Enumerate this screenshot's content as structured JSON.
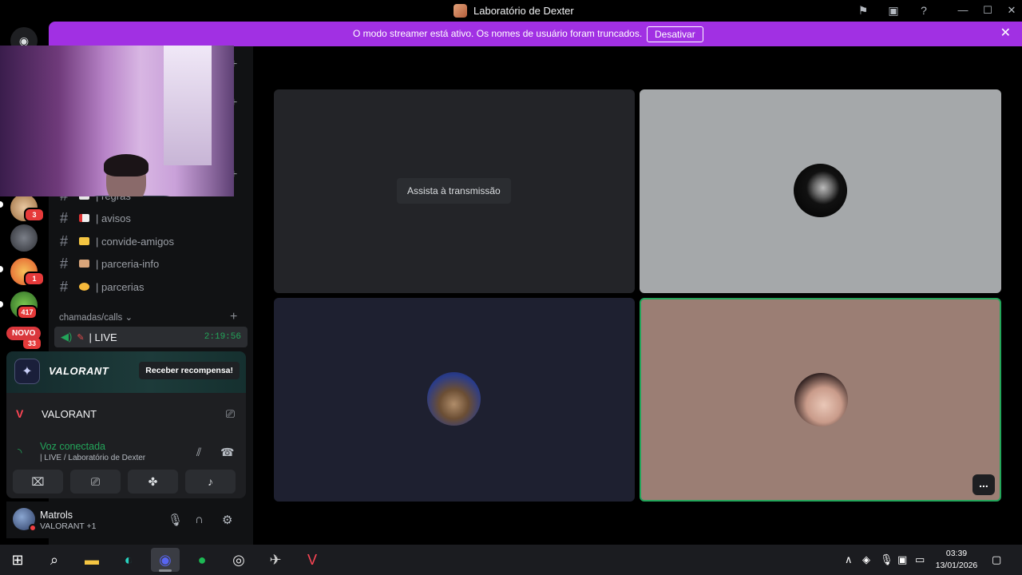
{
  "window": {
    "title": "Laboratório de Dexter"
  },
  "banner": {
    "message": "O modo streamer está ativo. Os nomes de usuário foram truncados.",
    "button_label": "Desativar"
  },
  "rail": {
    "badges": [
      "3",
      "1",
      "417",
      "33"
    ],
    "new_label": "NOVO"
  },
  "sidebar": {
    "channels": [
      {
        "label": "| regras"
      },
      {
        "label": "| avisos"
      },
      {
        "label": "| convide-amigos"
      },
      {
        "label": "| parceria-info"
      },
      {
        "label": "| parcerias"
      }
    ],
    "category": "chamadas/calls",
    "voice_channel": {
      "label": "| LIVE",
      "timer": "2:19:56"
    }
  },
  "activity": {
    "game_name": "VALORANT",
    "cta": "Receber recompensa!"
  },
  "panel": {
    "game": "VALORANT",
    "voice_status": "Voz conectada",
    "voice_location": "| LIVE / Laboratório de Dexter"
  },
  "user": {
    "name": "Matrols",
    "status": "VALORANT +1"
  },
  "stage": {
    "watch_stream": "Assista à transmissão",
    "more": "..."
  },
  "taskbar": {
    "time": "03:39",
    "date": "13/01/2026"
  },
  "colors": {
    "banner": "#a130e3",
    "accent_green": "#23a55a",
    "badge_red": "#e63a3a"
  }
}
